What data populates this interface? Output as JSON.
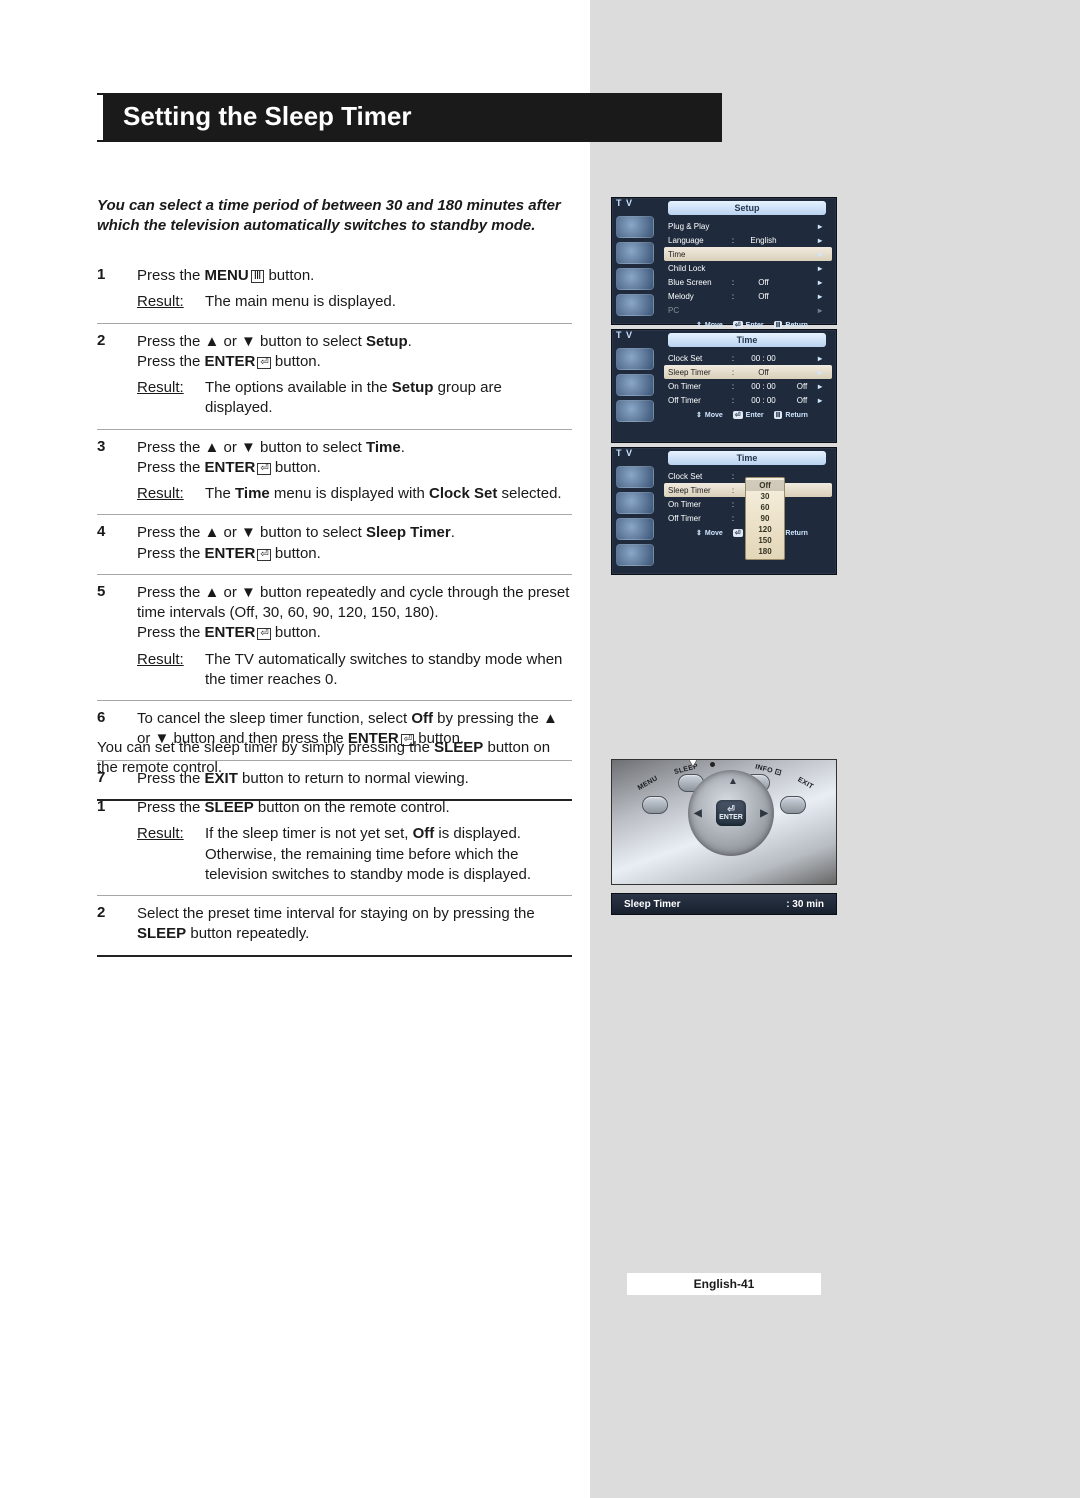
{
  "header": {
    "title": "Setting the Sleep Timer"
  },
  "intro": "You can select a time period of between 30 and 180 minutes after which the television automatically switches to standby mode.",
  "labels": {
    "result": "Result:"
  },
  "steps_main": [
    {
      "num": "1",
      "text_pre": "Press the ",
      "text_b1": "MENU",
      "text_post1": " button.",
      "result": "The main menu is displayed.",
      "has_result": true,
      "icon": "menu"
    },
    {
      "num": "2",
      "line1a": "Press the ▲ or ▼ button to select ",
      "line1b": "Setup",
      "line1c": ".",
      "line2a": "Press the ",
      "line2b": "ENTER",
      "line2c": " button.",
      "result_a": "The options available in the ",
      "result_b": "Setup",
      "result_c": " group are displayed.",
      "has_result": true
    },
    {
      "num": "3",
      "line1a": "Press the ▲ or ▼ button to select ",
      "line1b": "Time",
      "line1c": ".",
      "line2a": "Press the ",
      "line2b": "ENTER",
      "line2c": " button.",
      "result_a": "The ",
      "result_b": "Time",
      "result_c": " menu is displayed with ",
      "result_d": "Clock Set",
      "result_e": " selected.",
      "has_result": true
    },
    {
      "num": "4",
      "line1a": "Press the ▲ or ▼ button to select ",
      "line1b": "Sleep Timer",
      "line1c": ".",
      "line2a": "Press the ",
      "line2b": "ENTER",
      "line2c": " button.",
      "has_result": false
    },
    {
      "num": "5",
      "body1": "Press the ▲ or ▼ button repeatedly and cycle through the preset time intervals (Off, 30, 60, 90, 120, 150, 180).",
      "line2a": "Press the ",
      "line2b": "ENTER",
      "line2c": " button.",
      "result": "The TV automatically switches to standby mode when the timer reaches 0.",
      "has_result": true
    },
    {
      "num": "6",
      "text_a": "To cancel the sleep timer function, select ",
      "text_b": "Off",
      "text_c": " by pressing the ▲ or ▼ button and then press the ",
      "text_d": "ENTER",
      "text_e": " button.",
      "has_result": false
    },
    {
      "num": "7",
      "text_a": "Press the ",
      "text_b": "EXIT",
      "text_c": " button to return to normal viewing.",
      "has_result": false
    }
  ],
  "note": {
    "a": "You can set the sleep timer by simply pressing the ",
    "b": "SLEEP",
    "c": " button on the remote control."
  },
  "steps_remote": [
    {
      "num": "1",
      "line_a": "Press the ",
      "line_b": "SLEEP",
      "line_c": " button on the remote control.",
      "result_a": "If the sleep timer is not yet set, ",
      "result_b": "Off",
      "result_c": " is displayed. Otherwise, the remaining time before which the television switches to standby mode is displayed.",
      "has_result": true
    },
    {
      "num": "2",
      "line_a": "Select the preset time interval for staying on by pressing the ",
      "line_b": "SLEEP",
      "line_c": " button repeatedly.",
      "has_result": false
    }
  ],
  "osd1": {
    "tv": "T V",
    "title": "Setup",
    "rows": [
      {
        "l": "Plug & Play",
        "v": "",
        "x": "",
        "sel": false,
        "arr": "▸"
      },
      {
        "l": "Language",
        "v": "English",
        "x": "",
        "sel": false,
        "arr": "▸",
        "colon": ":"
      },
      {
        "l": "Time",
        "v": "",
        "x": "",
        "sel": true,
        "arr": "▸"
      },
      {
        "l": "Child Lock",
        "v": "",
        "x": "",
        "sel": false,
        "arr": "▸"
      },
      {
        "l": "Blue Screen",
        "v": "Off",
        "x": "",
        "sel": false,
        "arr": "▸",
        "colon": ":"
      },
      {
        "l": "Melody",
        "v": "Off",
        "x": "",
        "sel": false,
        "arr": "▸",
        "colon": ":"
      },
      {
        "l": "PC",
        "v": "",
        "x": "",
        "sel": false,
        "arr": "▸",
        "dim": true
      }
    ],
    "hint": {
      "move": "Move",
      "enter": "Enter",
      "ret": "Return"
    }
  },
  "osd2": {
    "tv": "T V",
    "title": "Time",
    "rows": [
      {
        "l": "Clock Set",
        "c": ":",
        "v": "00 : 00",
        "x": "",
        "sel": false,
        "arr": "▸"
      },
      {
        "l": "Sleep Timer",
        "c": ":",
        "v": "Off",
        "x": "",
        "sel": true,
        "arr": "▸"
      },
      {
        "l": "On Timer",
        "c": ":",
        "v": "00 : 00",
        "x": "Off",
        "sel": false,
        "arr": "▸"
      },
      {
        "l": "Off Timer",
        "c": ":",
        "v": "00 : 00",
        "x": "Off",
        "sel": false,
        "arr": "▸"
      }
    ],
    "hint": {
      "move": "Move",
      "enter": "Enter",
      "ret": "Return"
    }
  },
  "osd3": {
    "tv": "T V",
    "title": "Time",
    "rows": [
      {
        "l": "Clock Set",
        "c": ":",
        "v": "",
        "x": "",
        "sel": false,
        "arr": ""
      },
      {
        "l": "Sleep Timer",
        "c": ":",
        "v": "",
        "x": "",
        "sel": true,
        "arr": ""
      },
      {
        "l": "On Timer",
        "c": ":",
        "v": "",
        "x": "",
        "sel": false,
        "arr": ""
      },
      {
        "l": "Off Timer",
        "c": ":",
        "v": "",
        "x": "",
        "sel": false,
        "arr": ""
      }
    ],
    "popup": [
      "Off",
      "30",
      "60",
      "90",
      "120",
      "150",
      "180"
    ],
    "popup_sel_index": 0,
    "hint": {
      "move": "Move",
      "enter": "Enter",
      "ret": "Return"
    }
  },
  "remote": {
    "menu": "MENU",
    "sleep": "SLEEP",
    "info": "INFO",
    "exit": "EXIT",
    "enter": "ENTER",
    "entersym": "⏎"
  },
  "status": {
    "left": "Sleep Timer",
    "right": ":  30 min"
  },
  "pagenum": "English-41"
}
